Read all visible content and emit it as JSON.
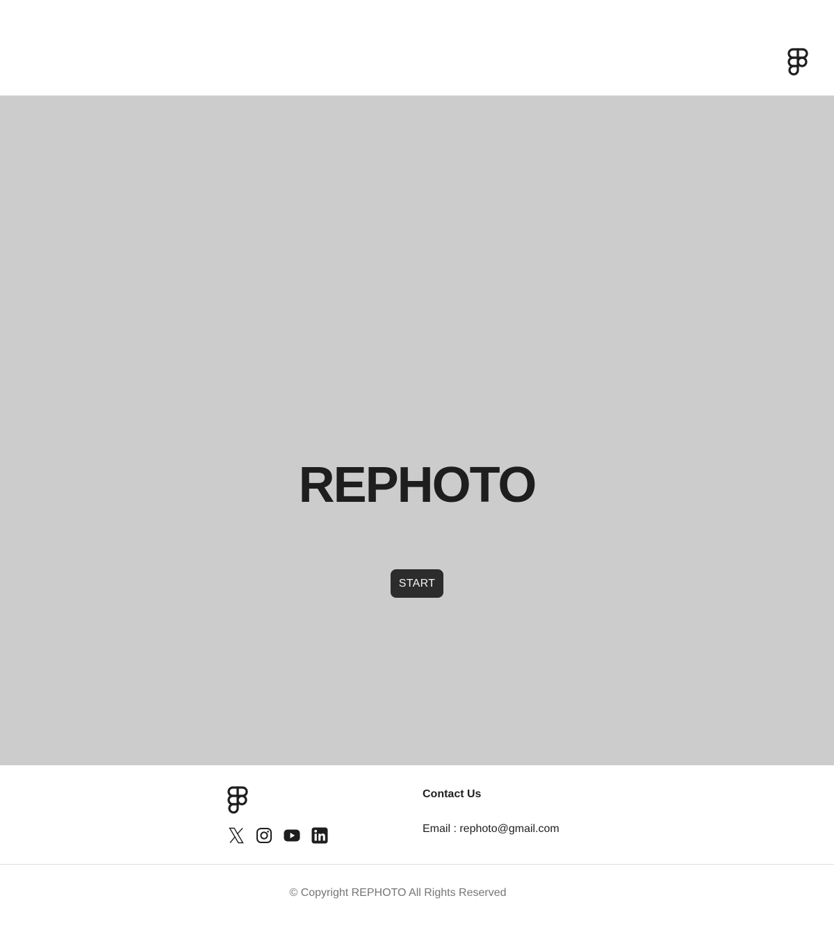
{
  "header": {
    "logo_icon": "figma-logo-icon"
  },
  "hero": {
    "title": "REPHOTO",
    "start_label": "START",
    "background": "#cccccc"
  },
  "footer": {
    "logo_icon": "figma-logo-icon",
    "social_icons": [
      "x-twitter-icon",
      "instagram-icon",
      "youtube-icon",
      "linkedin-icon"
    ],
    "contact_heading": "Contact Us",
    "contact_email": "Email : rephoto@gmail.com"
  },
  "copyright": "© Copyright REPHOTO All Rights Reserved",
  "colors": {
    "text_primary": "#1e1e1e",
    "button_bg": "#2c2c2c",
    "muted_text": "#757575"
  }
}
